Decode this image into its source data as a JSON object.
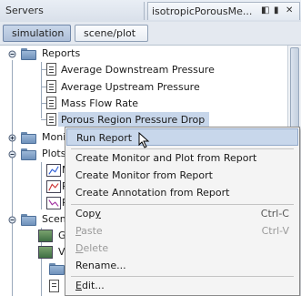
{
  "header": {
    "servers_label": "Servers",
    "window_title": "isotropicPorousMe...",
    "controls": [
      "◧",
      "▮",
      "✕"
    ]
  },
  "tabs": [
    {
      "label": "simulation",
      "active": true
    },
    {
      "label": "scene/plot",
      "active": false
    }
  ],
  "tree": {
    "reports_label": "Reports",
    "report_items": [
      "Average Downstream Pressure",
      "Average Upstream Pressure",
      "Mass Flow Rate",
      "Porous Region Pressure Drop"
    ],
    "monitors_label": "Moni",
    "plots_label": "Plots",
    "plot_items": [
      "M",
      "R",
      "P"
    ],
    "scenes_label": "Scen",
    "scene_items": [
      "G",
      "V"
    ]
  },
  "context_menu": {
    "items": [
      {
        "label": "Run Report",
        "shortcut": "",
        "disabled": false,
        "hover": true
      },
      {
        "label": "Create Monitor and Plot from Report",
        "shortcut": "",
        "disabled": false
      },
      {
        "label": "Create Monitor from Report",
        "shortcut": "",
        "disabled": false
      },
      {
        "label": "Create Annotation from Report",
        "shortcut": "",
        "disabled": false
      },
      {
        "label": "Copy",
        "shortcut": "Ctrl-C",
        "disabled": false,
        "mnemonic": "y"
      },
      {
        "label": "Paste",
        "shortcut": "Ctrl-V",
        "disabled": true,
        "mnemonic": "P"
      },
      {
        "label": "Delete",
        "shortcut": "",
        "disabled": true,
        "mnemonic": "D"
      },
      {
        "label": "Rename...",
        "shortcut": "",
        "disabled": false
      },
      {
        "label": "Edit...",
        "shortcut": "",
        "disabled": false,
        "mnemonic": "E"
      }
    ]
  },
  "colors": {
    "selection": "#c7d6ea",
    "menu_hover": "#c8d7eb",
    "active_tab": "#aebfd8"
  }
}
